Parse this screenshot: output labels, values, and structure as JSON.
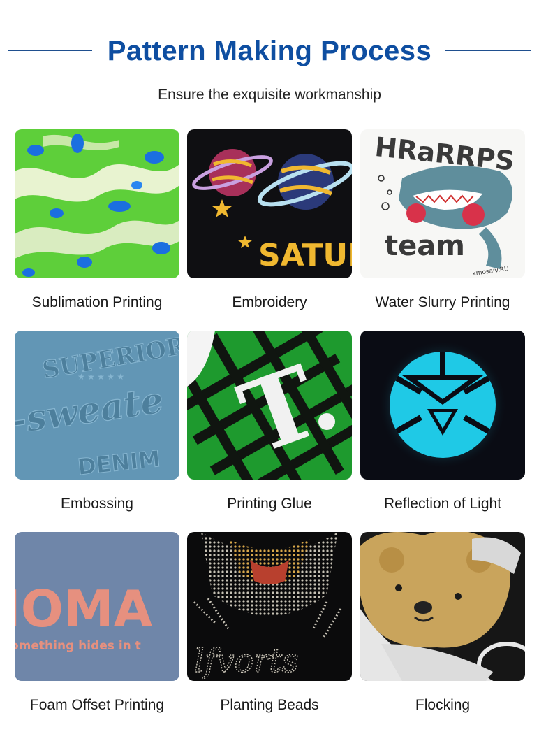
{
  "header": {
    "title": "Pattern Making Process",
    "subtitle": "Ensure the exquisite workmanship"
  },
  "tiles": [
    {
      "label": "Sublimation Printing"
    },
    {
      "label": "Embroidery"
    },
    {
      "label": "Water Slurry Printing"
    },
    {
      "label": "Embossing"
    },
    {
      "label": "Printing Glue"
    },
    {
      "label": "Reflection of Light"
    },
    {
      "label": "Foam Offset Printing"
    },
    {
      "label": "Planting Beads"
    },
    {
      "label": "Flocking"
    }
  ],
  "image_text": {
    "embroidery_word": "SATUR",
    "slurry_top": "HRaRRPS",
    "slurry_bottom": "team",
    "slurry_small": "kmosaiv.RU",
    "emboss_top": "SUPERIOR",
    "emboss_mid": "-sweate",
    "emboss_bottom": "DENIM",
    "glue_letter": "T",
    "foam_big": "IOMA",
    "foam_small": "omething hides in t",
    "beads_word": "lfvorts"
  },
  "colors": {
    "title_blue": "#0e4ea1",
    "rule_blue": "#1f4f8f"
  }
}
